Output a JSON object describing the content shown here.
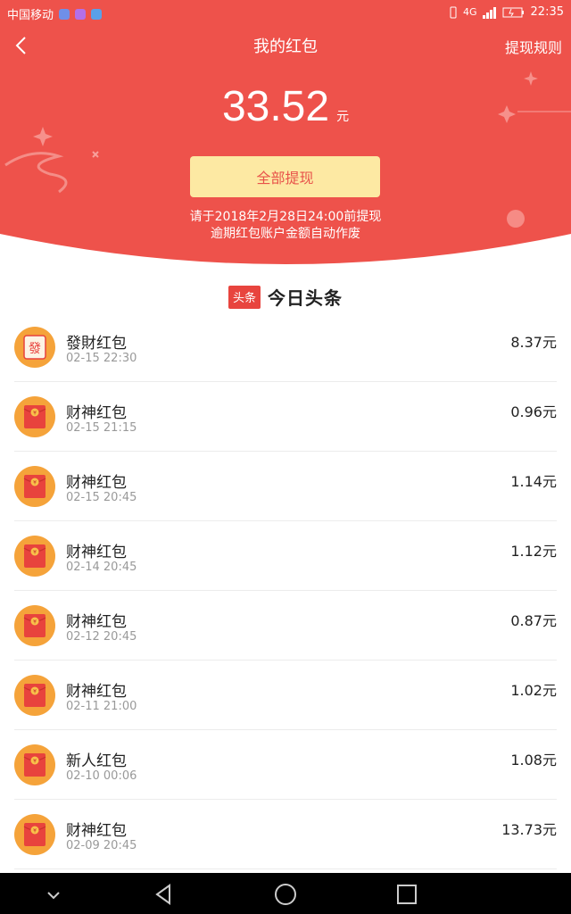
{
  "status_bar": {
    "carrier": "中国移动",
    "network": "4G",
    "time": "22:35"
  },
  "nav": {
    "title": "我的红包",
    "rules": "提现规则"
  },
  "balance": {
    "amount": "33.52",
    "unit": "元"
  },
  "withdraw": {
    "label": "全部提现"
  },
  "notice": {
    "line1": "请于2018年2月28日24:00前提现",
    "line2": "逾期红包账户金额自动作废"
  },
  "brand": {
    "badge": "头条",
    "name": "今日头条"
  },
  "icon_glyphs": {
    "fa_icon": "發",
    "yuan_icon": "¥"
  },
  "items": [
    {
      "name": "發財红包",
      "time": "02-15 22:30",
      "amount": "8.37元",
      "icon": "fa-icon"
    },
    {
      "name": "财神红包",
      "time": "02-15 21:15",
      "amount": "0.96元",
      "icon": "yuan-envelope-icon"
    },
    {
      "name": "财神红包",
      "time": "02-15 20:45",
      "amount": "1.14元",
      "icon": "yuan-envelope-icon"
    },
    {
      "name": "财神红包",
      "time": "02-14 20:45",
      "amount": "1.12元",
      "icon": "yuan-envelope-icon"
    },
    {
      "name": "财神红包",
      "time": "02-12 20:45",
      "amount": "0.87元",
      "icon": "yuan-envelope-icon"
    },
    {
      "name": "财神红包",
      "time": "02-11 21:00",
      "amount": "1.02元",
      "icon": "yuan-envelope-icon"
    },
    {
      "name": "新人红包",
      "time": "02-10 00:06",
      "amount": "1.08元",
      "icon": "yuan-envelope-icon"
    },
    {
      "name": "财神红包",
      "time": "02-09 20:45",
      "amount": "13.73元",
      "icon": "yuan-envelope-icon"
    }
  ],
  "colors": {
    "header_red": "#ee524b",
    "button_yellow": "#fde9a3",
    "icon_orange": "#f5a33a",
    "envelope_red": "#e8433d"
  }
}
